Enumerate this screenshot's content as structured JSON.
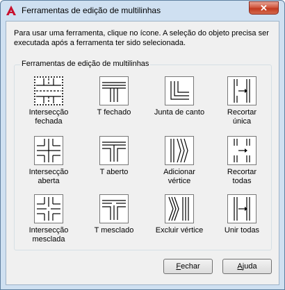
{
  "window": {
    "title": "Ferramentas de edição de multilinhas",
    "close_label": "✕"
  },
  "description": "Para usar uma ferramenta, clique no ícone. A seleção do objeto precisa ser executada após a ferramenta ter sido selecionada.",
  "group_title": "Ferramentas de edição de multilinhas",
  "tools": [
    {
      "label_l1": "Intersecção",
      "label_l2": "fechada",
      "icon": "closed-cross-icon"
    },
    {
      "label_l1": "T fechado",
      "label_l2": "",
      "icon": "closed-tee-icon"
    },
    {
      "label_l1": "Junta de canto",
      "label_l2": "",
      "icon": "corner-joint-icon"
    },
    {
      "label_l1": "Recortar",
      "label_l2": "única",
      "icon": "cut-single-icon"
    },
    {
      "label_l1": "Intersecção",
      "label_l2": "aberta",
      "icon": "open-cross-icon"
    },
    {
      "label_l1": "T aberto",
      "label_l2": "",
      "icon": "open-tee-icon"
    },
    {
      "label_l1": "Adicionar",
      "label_l2": "vértice",
      "icon": "add-vertex-icon"
    },
    {
      "label_l1": "Recortar",
      "label_l2": "todas",
      "icon": "cut-all-icon"
    },
    {
      "label_l1": "Intersecção",
      "label_l2": "mesclada",
      "icon": "merged-cross-icon"
    },
    {
      "label_l1": "T mesclado",
      "label_l2": "",
      "icon": "merged-tee-icon"
    },
    {
      "label_l1": "Excluir vértice",
      "label_l2": "",
      "icon": "delete-vertex-icon"
    },
    {
      "label_l1": "Unir todas",
      "label_l2": "",
      "icon": "weld-all-icon"
    }
  ],
  "buttons": {
    "close_first": "F",
    "close_rest": "echar",
    "help_first": "A",
    "help_rest": "juda"
  }
}
